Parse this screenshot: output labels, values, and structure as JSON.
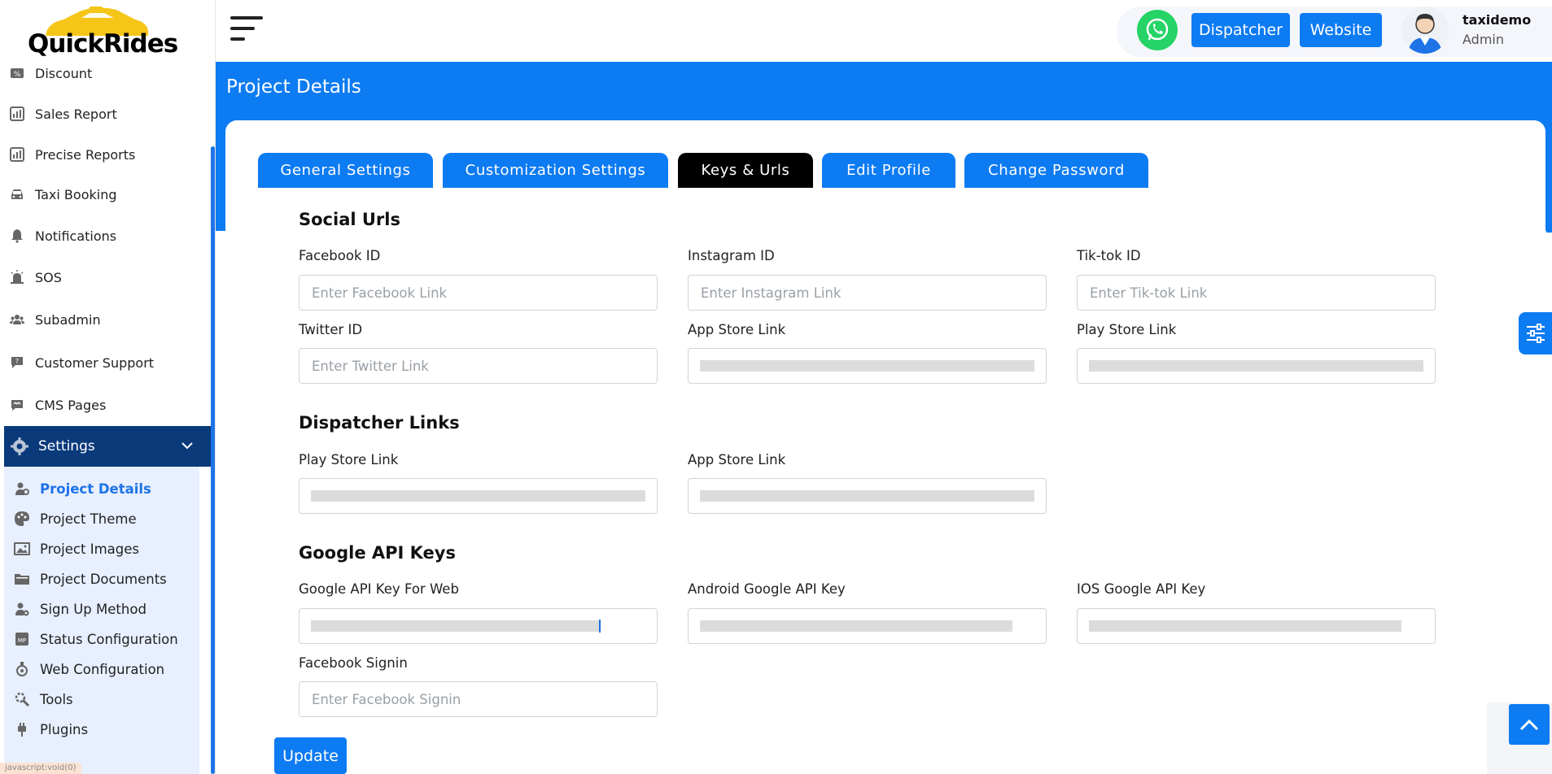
{
  "brand": {
    "logo_text": "QuickRides"
  },
  "sidebar": {
    "items": [
      {
        "label": "Discount",
        "icon": "discount-icon"
      },
      {
        "label": "Sales Report",
        "icon": "chart-icon"
      },
      {
        "label": "Precise Reports",
        "icon": "chart-icon"
      },
      {
        "label": "Taxi Booking",
        "icon": "car-icon"
      },
      {
        "label": "Notifications",
        "icon": "bell-icon"
      },
      {
        "label": "SOS",
        "icon": "alarm-icon"
      },
      {
        "label": "Subadmin",
        "icon": "users-icon"
      },
      {
        "label": "Customer Support",
        "icon": "chat-icon"
      },
      {
        "label": "CMS Pages",
        "icon": "pages-icon"
      }
    ],
    "settings": {
      "label": "Settings",
      "icon": "gear-icon"
    },
    "submenu": [
      {
        "label": "Project Details",
        "active": true
      },
      {
        "label": "Project Theme"
      },
      {
        "label": "Project Images"
      },
      {
        "label": "Project Documents"
      },
      {
        "label": "Sign Up Method"
      },
      {
        "label": "Status Configuration"
      },
      {
        "label": "Web Configuration"
      },
      {
        "label": "Tools"
      },
      {
        "label": "Plugins"
      }
    ],
    "status_tip": "javascript:void(0)"
  },
  "topbar": {
    "dispatcher_label": "Dispatcher",
    "website_label": "Website",
    "user_name": "taxidemo",
    "user_role": "Admin"
  },
  "page": {
    "title": "Project Details"
  },
  "tabs": [
    {
      "label": "General Settings"
    },
    {
      "label": "Customization Settings"
    },
    {
      "label": "Keys & Urls",
      "active": true
    },
    {
      "label": "Edit Profile"
    },
    {
      "label": "Change Password"
    }
  ],
  "social_urls": {
    "title": "Social Urls",
    "facebook": {
      "label": "Facebook ID",
      "placeholder": "Enter Facebook Link"
    },
    "instagram": {
      "label": "Instagram ID",
      "placeholder": "Enter Instagram Link"
    },
    "tiktok": {
      "label": "Tik-tok ID",
      "placeholder": "Enter Tik-tok Link"
    },
    "twitter": {
      "label": "Twitter ID",
      "placeholder": "Enter Twitter Link"
    },
    "app_store": {
      "label": "App Store Link"
    },
    "play_store": {
      "label": "Play Store Link"
    }
  },
  "dispatcher_links": {
    "title": "Dispatcher Links",
    "play_store": {
      "label": "Play Store Link"
    },
    "app_store": {
      "label": "App Store Link"
    }
  },
  "google_api_keys": {
    "title": "Google API Keys",
    "web": {
      "label": "Google API Key For Web"
    },
    "android": {
      "label": "Android Google API Key"
    },
    "ios": {
      "label": "IOS Google API Key"
    },
    "facebook_signin": {
      "label": "Facebook Signin",
      "placeholder": "Enter Facebook Signin"
    }
  },
  "actions": {
    "update_label": "Update"
  },
  "colors": {
    "primary": "#0d7bf2",
    "sidebar_active": "#0a3a7a",
    "submenu_bg": "#e8efff",
    "whatsapp": "#25d366"
  }
}
